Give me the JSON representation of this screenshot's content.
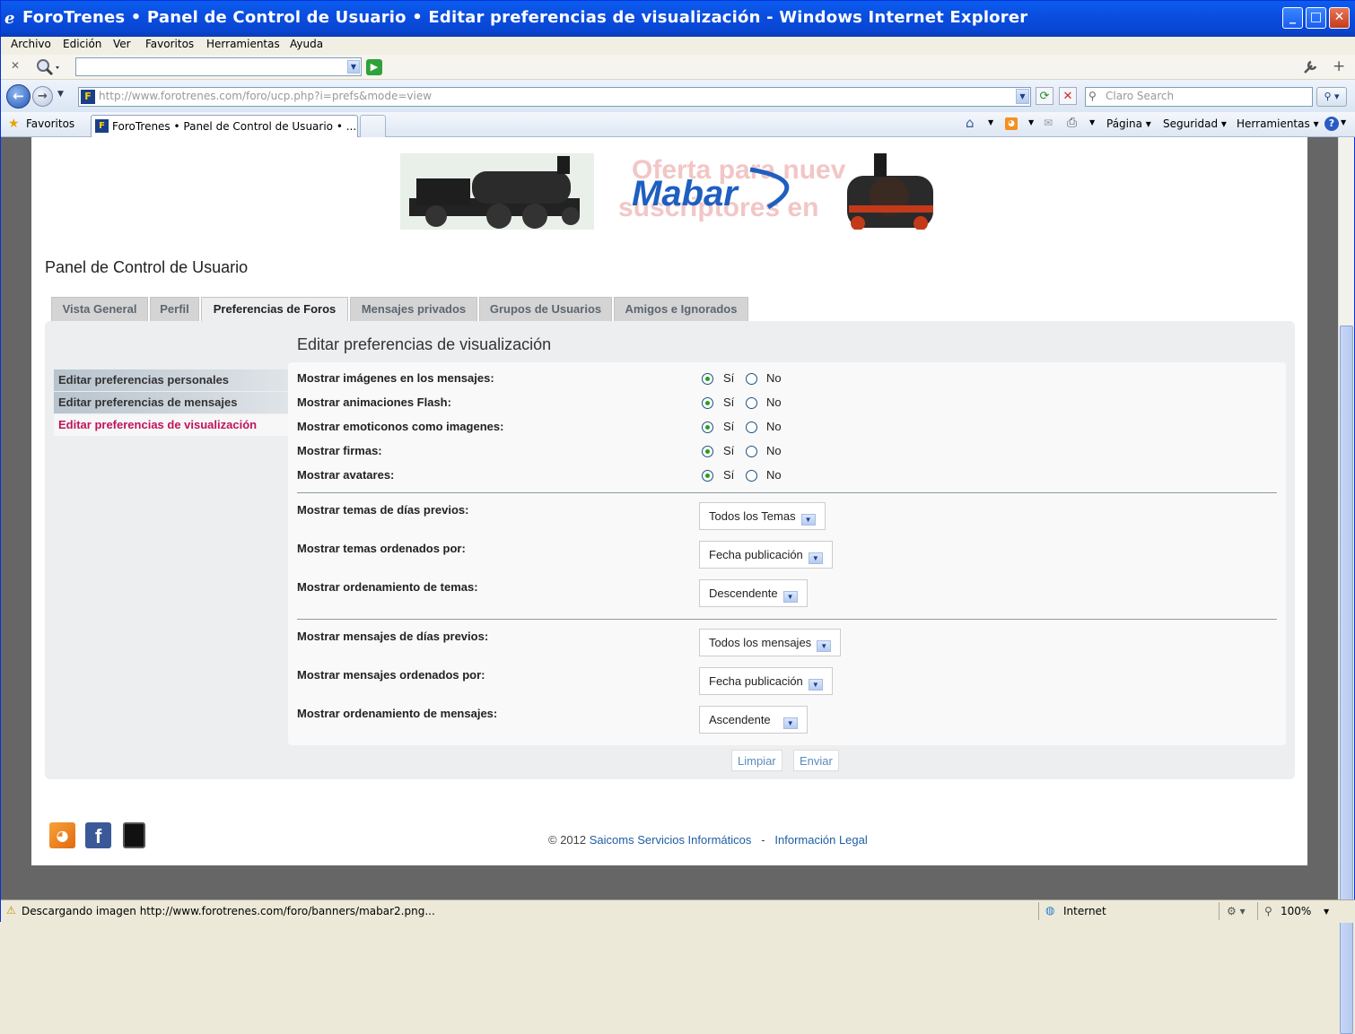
{
  "window": {
    "title": "ForoTrenes • Panel de Control de Usuario • Editar preferencias de visualización - Windows Internet Explorer",
    "controls": {
      "minimize": "_",
      "maximize": "□",
      "close": "✕"
    }
  },
  "menubar": [
    "Archivo",
    "Edición",
    "Ver",
    "Favoritos",
    "Herramientas",
    "Ayuda"
  ],
  "address": {
    "url": "http://www.forotrenes.com/foro/ucp.php?i=prefs&mode=view",
    "search_placeholder": "Claro Search"
  },
  "favbar": {
    "favorites_label": "Favoritos",
    "tab_label": "ForoTrenes • Panel de Control de Usuario • ...",
    "commands": [
      "Página",
      "Seguridad",
      "Herramientas"
    ]
  },
  "banner": {
    "brand": "Mabar",
    "ghost_text_1": "Oferta para nuev",
    "ghost_text_2": "suscriptores en"
  },
  "page_title": "Panel de Control de Usuario",
  "tabs": [
    "Vista General",
    "Perfil",
    "Preferencias de Foros",
    "Mensajes privados",
    "Grupos de Usuarios",
    "Amigos e Ignorados"
  ],
  "active_tab": "Preferencias de Foros",
  "section_title": "Editar preferencias de visualización",
  "sidenav": [
    "Editar preferencias personales",
    "Editar preferencias de mensajes",
    "Editar preferencias de visualización"
  ],
  "radio_fields": [
    {
      "label": "Mostrar imágenes en los mensajes:",
      "yes": "Sí",
      "no": "No",
      "value": "Sí"
    },
    {
      "label": "Mostrar animaciones Flash:",
      "yes": "Sí",
      "no": "No",
      "value": "Sí"
    },
    {
      "label": "Mostrar emoticonos como imagenes:",
      "yes": "Sí",
      "no": "No",
      "value": "Sí"
    },
    {
      "label": "Mostrar firmas:",
      "yes": "Sí",
      "no": "No",
      "value": "Sí"
    },
    {
      "label": "Mostrar avatares:",
      "yes": "Sí",
      "no": "No",
      "value": "Sí"
    }
  ],
  "select_fields": [
    {
      "label": "Mostrar temas de días previos:",
      "value": "Todos los Temas"
    },
    {
      "label": "Mostrar temas ordenados por:",
      "value": "Fecha publicación"
    },
    {
      "label": "Mostrar ordenamiento de temas:",
      "value": "Descendente"
    },
    {
      "label": "Mostrar mensajes de días previos:",
      "value": "Todos los mensajes"
    },
    {
      "label": "Mostrar mensajes ordenados por:",
      "value": "Fecha publicación"
    },
    {
      "label": "Mostrar ordenamiento de mensajes:",
      "value": "Ascendente"
    }
  ],
  "buttons": {
    "reset": "Limpiar",
    "submit": "Enviar"
  },
  "footer": {
    "copyright": "© 2012",
    "company": "Saicoms Servicios Informáticos",
    "separator": "-",
    "legal": "Información Legal"
  },
  "status": {
    "text": "Descargando imagen http://www.forotrenes.com/foro/banners/mabar2.png...",
    "zone": "Internet",
    "zoom": "100%"
  },
  "colors": {
    "titlebar": "#0b4ee0",
    "active_link": "#c0145b",
    "link": "#1e5da4",
    "panel_bg": "#eceeef"
  }
}
